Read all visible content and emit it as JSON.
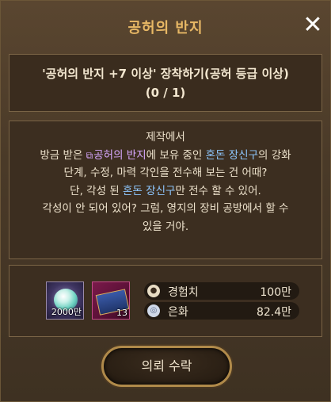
{
  "dialog": {
    "title": "공허의 반지",
    "close_icon": "close-icon"
  },
  "quest": {
    "objective": "'공허의 반지 +7 이상' 장착하기(공허 등급 이상)",
    "progress": "(0 / 1)"
  },
  "description": {
    "heading": "제작에서",
    "line2_pre": "방금 받은 ",
    "line2_link": "공허의 반지",
    "line2_mid": "에 보유 중인 ",
    "line2_highlight": "혼돈 장신구",
    "line2_post": "의 강화",
    "line3": "단계, 수정, 마력 각인을 전수해 보는 건 어때?",
    "line4_pre": "단, 각성 된 ",
    "line4_highlight": "혼돈 장신구",
    "line4_post": "만 전수 할 수 있어.",
    "line5": "각성이 안 되어 있어? 그럼, 영지의 장비 공방에서 할 수",
    "line6": "있을 거야.",
    "colors": {
      "link": "#d8a8ff",
      "highlight": "#8fc8ff"
    }
  },
  "rewards": {
    "items": [
      {
        "icon": "orb-item-icon",
        "count": "2000만"
      },
      {
        "icon": "chest-item-icon",
        "count": "13"
      }
    ],
    "stats": [
      {
        "icon": "experience-icon",
        "label": "경험치",
        "value": "100만"
      },
      {
        "icon": "silver-coin-icon",
        "label": "은화",
        "value": "82.4만"
      }
    ]
  },
  "accept_button": {
    "label": "의뢰 수락"
  }
}
